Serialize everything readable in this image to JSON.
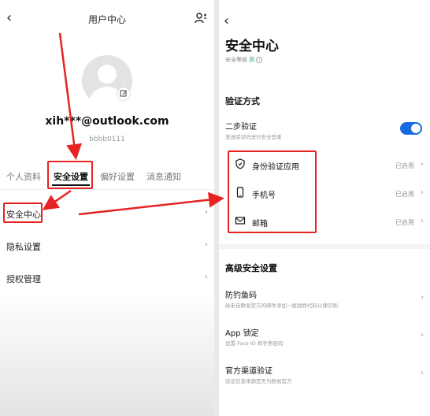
{
  "left": {
    "header": {
      "title": "用户中心"
    },
    "profile": {
      "email": "xih***@outlook.com",
      "user_id": "bbbb0111"
    },
    "tabs": [
      {
        "label": "个人资料"
      },
      {
        "label": "安全设置"
      },
      {
        "label": "偏好设置"
      },
      {
        "label": "消息通知"
      }
    ],
    "menu": [
      {
        "label": "安全中心"
      },
      {
        "label": "隐私设置"
      },
      {
        "label": "授权管理"
      }
    ]
  },
  "right": {
    "title": "安全中心",
    "security_level": {
      "label": "安全等级",
      "value": "高"
    },
    "verify_section": "验证方式",
    "two_step": {
      "label": "二步验证",
      "sub": "发送验证码进行安全登录",
      "enabled": true
    },
    "methods": [
      {
        "label": "身份验证应用",
        "status": "已启用",
        "icon": "shield-icon"
      },
      {
        "label": "手机号",
        "status": "已启用",
        "icon": "phone-icon"
      },
      {
        "label": "邮箱",
        "status": "已启用",
        "icon": "mail-icon"
      }
    ],
    "advanced_section": "高级安全设置",
    "advanced": [
      {
        "label": "防钓鱼码",
        "sub": "给来自欧易官方的邮件添加一组独特代码以便识别"
      },
      {
        "label": "App 锁定",
        "sub": "设置 Face ID 和手势密码"
      },
      {
        "label": "官方渠道验证",
        "sub": "验证信息来源是否为欧易官方"
      }
    ]
  },
  "colors": {
    "accent": "#1769e0",
    "annotation": "#e62222",
    "level_high": "#2aa36b"
  }
}
